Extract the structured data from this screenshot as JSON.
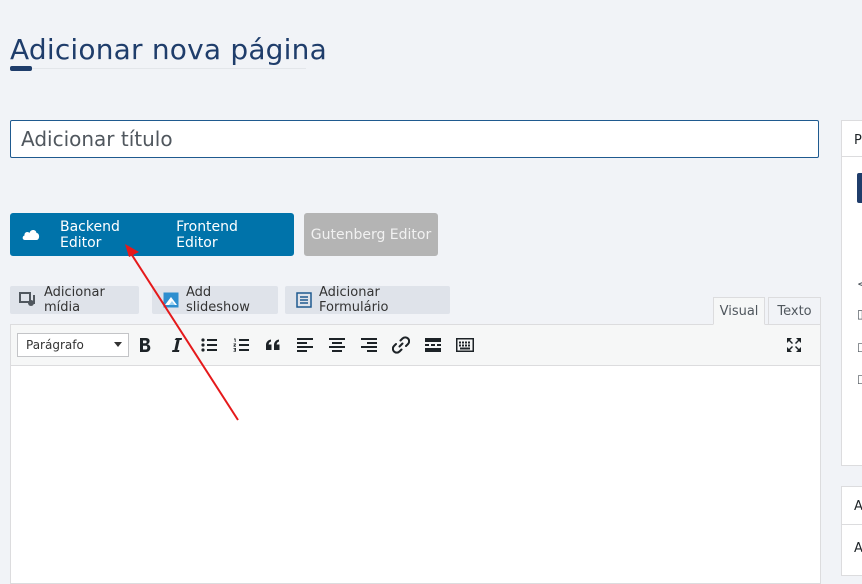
{
  "page": {
    "title": "Adicionar nova página"
  },
  "title_field": {
    "placeholder": "Adicionar título"
  },
  "editor_switch": {
    "backend_label": "Backend Editor",
    "frontend_label": "Frontend Editor",
    "gutenberg_label": "Gutenberg Editor"
  },
  "media_buttons": {
    "add_media": "Adicionar mídia",
    "add_slideshow": "Add slideshow",
    "add_form": "Adicionar Formulário"
  },
  "editor_tabs": {
    "visual": "Visual",
    "text": "Texto"
  },
  "toolbar": {
    "format_value": "Parágrafo",
    "icons": [
      "bold-icon",
      "italic-icon",
      "bullet-list-icon",
      "numbered-list-icon",
      "blockquote-icon",
      "align-left-icon",
      "align-center-icon",
      "align-right-icon",
      "link-icon",
      "read-more-icon",
      "toolbar-toggle-icon",
      "fullscreen-icon"
    ]
  },
  "sidebar": {
    "panel1_head": "P",
    "panel2_head": "A",
    "panel2_sub": "A"
  },
  "colors": {
    "primary": "#0073aa",
    "accent": "#1f3d6b",
    "annotation": "#e5191b",
    "disabled": "#b4b4b4"
  }
}
